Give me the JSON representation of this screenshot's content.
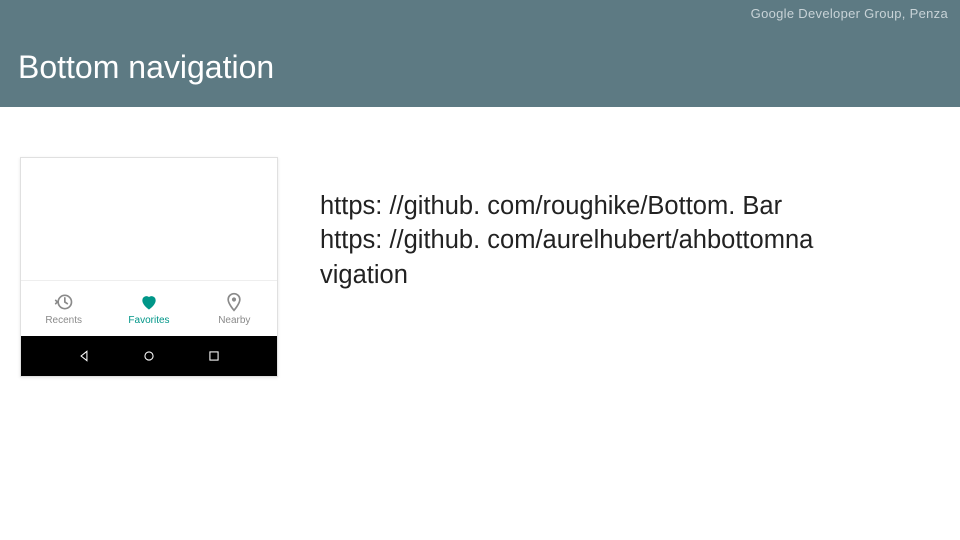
{
  "header": {
    "org": "Google Developer Group, Penza"
  },
  "title": "Bottom navigation",
  "links": {
    "line1": "https: //github. com/roughike/Bottom. Bar",
    "line2": "https: //github. com/aurelhubert/ahbottomna",
    "line3": "vigation"
  },
  "bottom_nav": {
    "items": [
      {
        "label": "Recents",
        "icon": "history-icon",
        "active": false
      },
      {
        "label": "Favorites",
        "icon": "heart-icon",
        "active": true
      },
      {
        "label": "Nearby",
        "icon": "pin-icon",
        "active": false
      }
    ]
  },
  "android_nav": {
    "back": "back-triangle",
    "home": "home-circle",
    "recent": "recent-square"
  },
  "colors": {
    "header_bg": "#5d7a83",
    "accent": "#009688"
  }
}
